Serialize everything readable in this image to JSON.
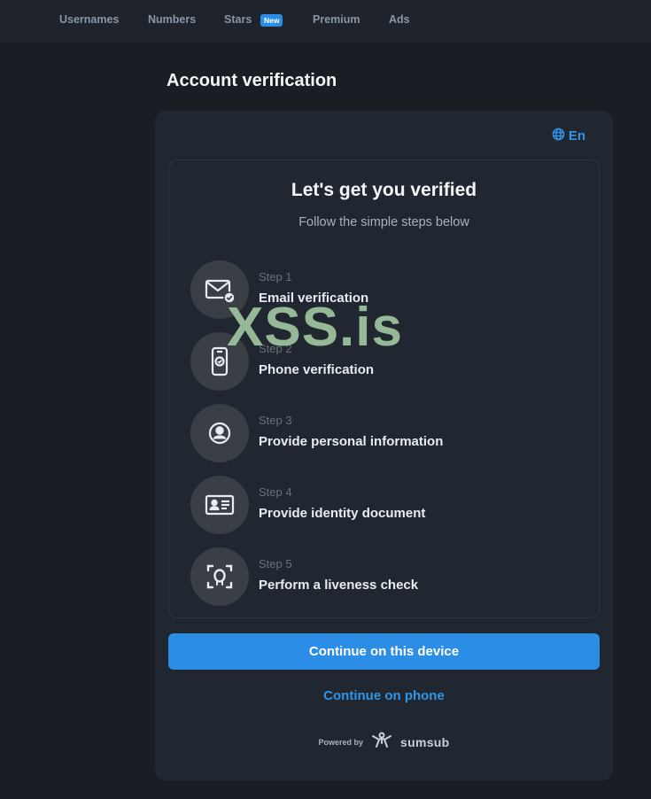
{
  "nav": {
    "items": [
      "Usernames",
      "Numbers",
      "Stars",
      "Premium",
      "Ads"
    ],
    "badge": "New"
  },
  "page": {
    "title": "Account verification"
  },
  "verification": {
    "language": "En",
    "heading": "Let's get you verified",
    "subheading": "Follow the simple steps below",
    "steps": [
      {
        "number": "Step 1",
        "label": "Email verification",
        "icon": "envelope-check-icon",
        "status": "completed"
      },
      {
        "number": "Step 2",
        "label": "Phone verification",
        "icon": "phone-check-icon",
        "status": "current"
      },
      {
        "number": "Step 3",
        "label": "Provide personal information",
        "icon": "person-circle-icon"
      },
      {
        "number": "Step 4",
        "label": "Provide identity document",
        "icon": "id-card-icon"
      },
      {
        "number": "Step 5",
        "label": "Perform a liveness check",
        "icon": "face-scan-icon"
      }
    ],
    "continue_device": "Continue on this device",
    "continue_phone": "Continue on phone",
    "powered_by": "Powered by",
    "provider": "sumsub"
  },
  "watermark": "XSS.is",
  "colors": {
    "accent": "#2b8de6",
    "background": "#191d24",
    "card": "#212730",
    "watermark": "#9fc6a0"
  }
}
